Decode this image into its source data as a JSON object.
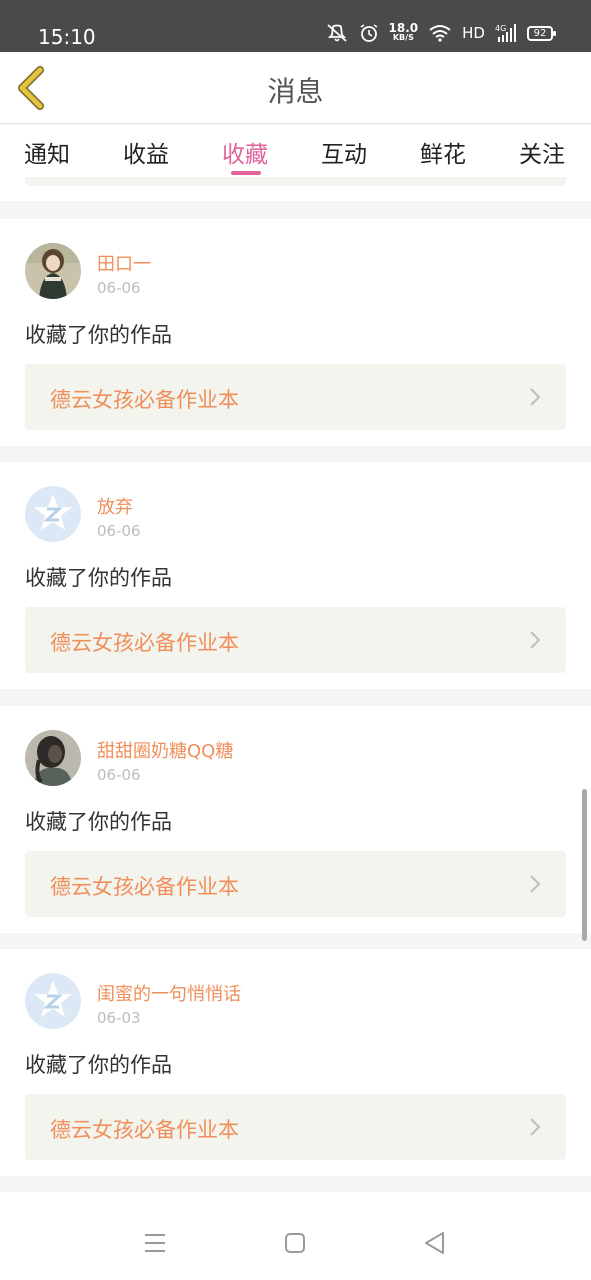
{
  "status_bar": {
    "time": "15:10",
    "speed_value": "18.0",
    "speed_unit": "KB/S",
    "network": "HD",
    "signal": "4G",
    "battery": "92",
    "icons": [
      "mute-icon",
      "alarm-icon",
      "wifi-icon",
      "signal-icon",
      "battery-icon"
    ]
  },
  "header": {
    "title": "消息",
    "back_icon": "chevron-left-icon"
  },
  "tabs": [
    {
      "label": "通知"
    },
    {
      "label": "收益"
    },
    {
      "label": "收藏"
    },
    {
      "label": "互动"
    },
    {
      "label": "鲜花"
    },
    {
      "label": "关注"
    }
  ],
  "active_tab": "收藏",
  "colors": {
    "accent_pink": "#e0639b",
    "accent_orange": "#ef8f5b",
    "back_arrow": "#e0b63a",
    "card_bg": "#f4f4ee"
  },
  "items": [
    {
      "username": "田口一",
      "date": "06-06",
      "action": "收藏了你的作品",
      "work": "德云女孩必备作业本",
      "avatar": "photo-girl"
    },
    {
      "username": "放弃",
      "date": "06-06",
      "action": "收藏了你的作品",
      "work": "德云女孩必备作业本",
      "avatar": "default-z"
    },
    {
      "username": "甜甜圈奶糖QQ糖",
      "date": "06-06",
      "action": "收藏了你的作品",
      "work": "德云女孩必备作业本",
      "avatar": "photo-dark"
    },
    {
      "username": "闺蜜的一句悄悄话",
      "date": "06-03",
      "action": "收藏了你的作品",
      "work": "德云女孩必备作业本",
      "avatar": "default-z"
    }
  ],
  "bottom_nav": [
    "menu-icon",
    "home-square-icon",
    "back-triangle-icon"
  ]
}
